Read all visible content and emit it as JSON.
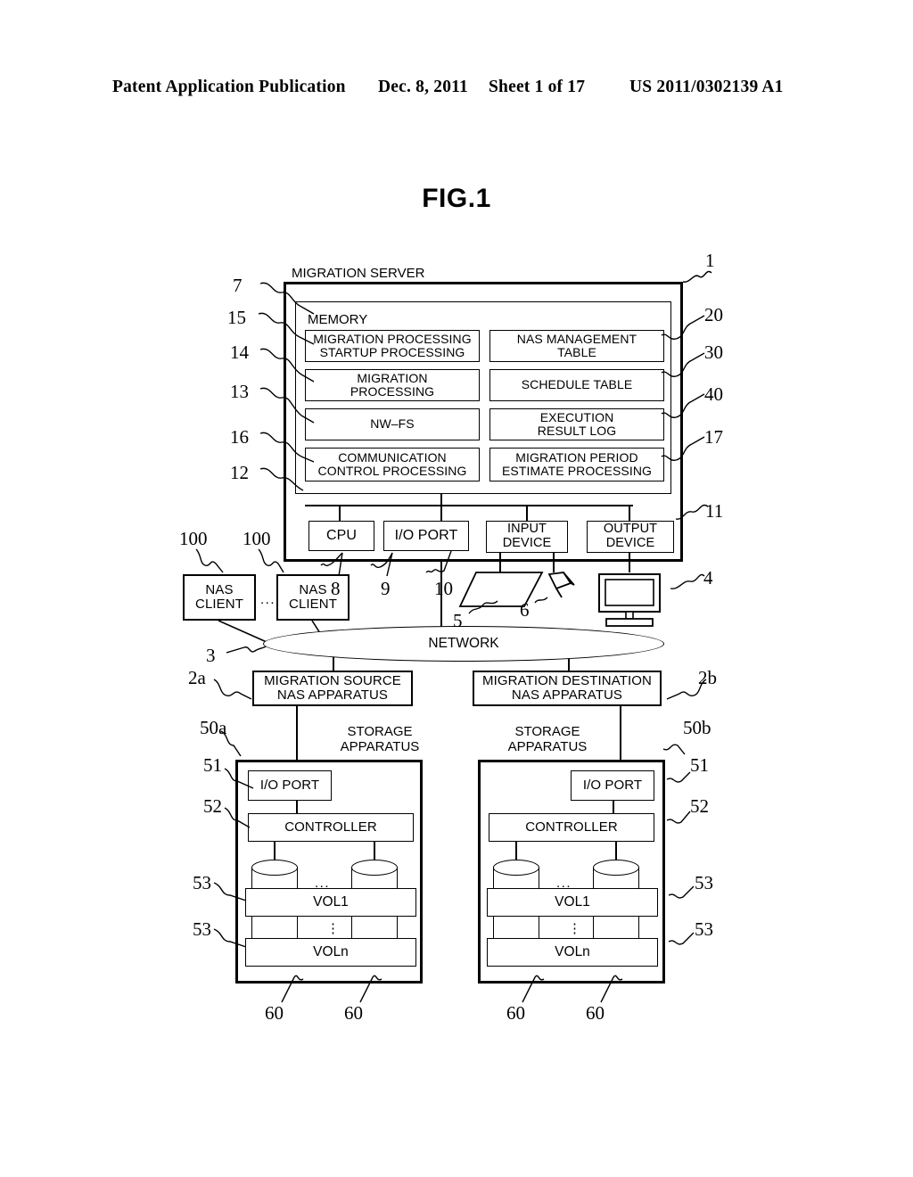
{
  "header": {
    "publication": "Patent Application Publication",
    "date": "Dec. 8, 2011",
    "sheet": "Sheet 1 of 17",
    "number": "US 2011/0302139 A1"
  },
  "figure": {
    "title": "FIG.1"
  },
  "server": {
    "title": "MIGRATION SERVER",
    "ref": "1",
    "ref_body": "11",
    "memory": {
      "title": "MEMORY",
      "ref": "7",
      "modules": [
        {
          "label": "MIGRATION PROCESSING\nSTARTUP PROCESSING",
          "line1": "MIGRATION PROCESSING",
          "line2": "STARTUP PROCESSING",
          "ref": "15"
        },
        {
          "label": "NAS MANAGEMENT\nTABLE",
          "line1": "NAS MANAGEMENT",
          "line2": "TABLE",
          "ref": "20"
        },
        {
          "label": "MIGRATION\nPROCESSING",
          "line1": "MIGRATION",
          "line2": "PROCESSING",
          "ref": "14"
        },
        {
          "label": "SCHEDULE TABLE",
          "line1": "SCHEDULE TABLE",
          "line2": "",
          "ref": "30"
        },
        {
          "label": "NW-FS",
          "line1": "NW–FS",
          "line2": "",
          "ref": "13"
        },
        {
          "label": "EXECUTION\nRESULT LOG",
          "line1": "EXECUTION",
          "line2": "RESULT LOG",
          "ref": "40"
        },
        {
          "label": "COMMUNICATION\nCONTROL PROCESSING",
          "line1": "COMMUNICATION",
          "line2": "CONTROL PROCESSING",
          "ref": "16"
        },
        {
          "label": "MIGRATION PERIOD\nESTIMATE PROCESSING",
          "line1": "MIGRATION PERIOD",
          "line2": "ESTIMATE PROCESSING",
          "ref": "17"
        }
      ],
      "left_refs": [
        "7",
        "15",
        "14",
        "13",
        "16",
        "12"
      ],
      "right_refs": [
        "20",
        "30",
        "40",
        "17"
      ]
    },
    "hardware": [
      {
        "line1": "CPU",
        "line2": "",
        "ref": "8"
      },
      {
        "line1": "I/O PORT",
        "line2": "",
        "ref": "9"
      },
      {
        "line1": "INPUT",
        "line2": "DEVICE",
        "ref": "10"
      },
      {
        "line1": "OUTPUT",
        "line2": "DEVICE",
        "ref": ""
      }
    ]
  },
  "peripherals": {
    "keyboard_ref": "5",
    "mouse_ref": "6",
    "monitor_ref": "4"
  },
  "clients": {
    "label_line1": "NAS",
    "label_line2": "CLIENT",
    "ref_left": "100",
    "ref_right": "100",
    "ellipsis": "..."
  },
  "network": {
    "label": "NETWORK",
    "ref": "3"
  },
  "nas_apparatus": [
    {
      "line1": "MIGRATION SOURCE",
      "line2": "NAS APPARATUS",
      "ref": "2a"
    },
    {
      "line1": "MIGRATION DESTINATION",
      "line2": "NAS APPARATUS",
      "ref": "2b"
    }
  ],
  "storage": {
    "title_line1": "STORAGE",
    "title_line2": "APPARATUS",
    "io_port": "I/O PORT",
    "controller": "CONTROLLER",
    "vol_first": "VOL1",
    "vol_last": "VOLn",
    "disk_ellipsis": "...",
    "vol_ellipsis": "⋮",
    "left": {
      "ref_apparatus": "50a",
      "ref_io_port": "51",
      "ref_controller": "52",
      "ref_vol1": "53",
      "ref_voln": "53",
      "ref_disk_left": "60",
      "ref_disk_right": "60"
    },
    "right": {
      "ref_apparatus": "50b",
      "ref_io_port": "51",
      "ref_controller": "52",
      "ref_vol1": "53",
      "ref_voln": "53",
      "ref_disk_left": "60",
      "ref_disk_right": "60"
    }
  }
}
